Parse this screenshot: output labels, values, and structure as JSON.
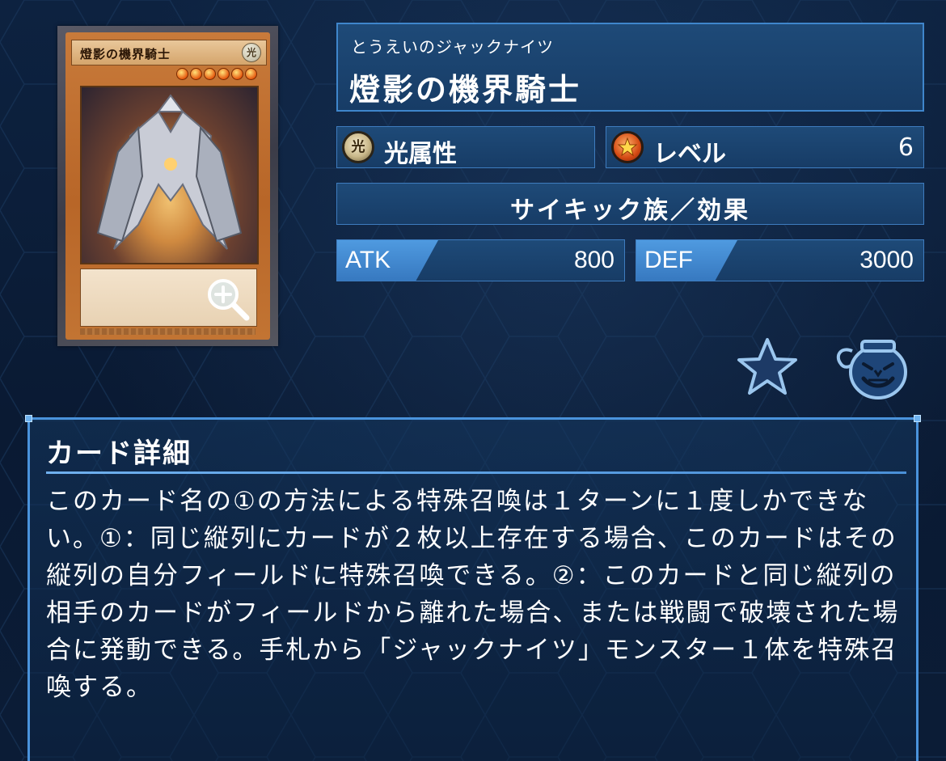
{
  "card": {
    "ruby": "とうえいのジャックナイツ",
    "name": "燈影の機界騎士",
    "printed_name": "燈影の機界騎士",
    "attribute_icon_glyph": "光",
    "level_stars": 6
  },
  "attribute": {
    "icon_glyph": "光",
    "label": "光属性"
  },
  "level": {
    "icon": "level-star-icon",
    "label": "レベル",
    "value": "6"
  },
  "type": {
    "label": "サイキック族／効果"
  },
  "stats": {
    "atk_label": "ATK",
    "atk_value": "800",
    "def_label": "DEF",
    "def_value": "3000"
  },
  "actions": {
    "zoom_icon": "zoom-in-icon",
    "favorite_icon": "star-icon",
    "pot_icon": "pot-of-greed-icon"
  },
  "detail": {
    "title": "カード詳細",
    "text": "このカード名の①の方法による特殊召喚は１ターンに１度しかできない。①：同じ縦列にカードが２枚以上存在する場合、このカードはその縦列の自分フィールドに特殊召喚できる。②：このカードと同じ縦列の相手のカードがフィールドから離れた場合、または戦闘で破壊された場合に発動できる。手札から「ジャックナイツ」モンスター１体を特殊召喚する。"
  },
  "colors": {
    "panel": "#1e4a78",
    "panel_border": "#3e7cbf",
    "stat_tag": "#4f9ae0",
    "background": "#0a1a30"
  }
}
